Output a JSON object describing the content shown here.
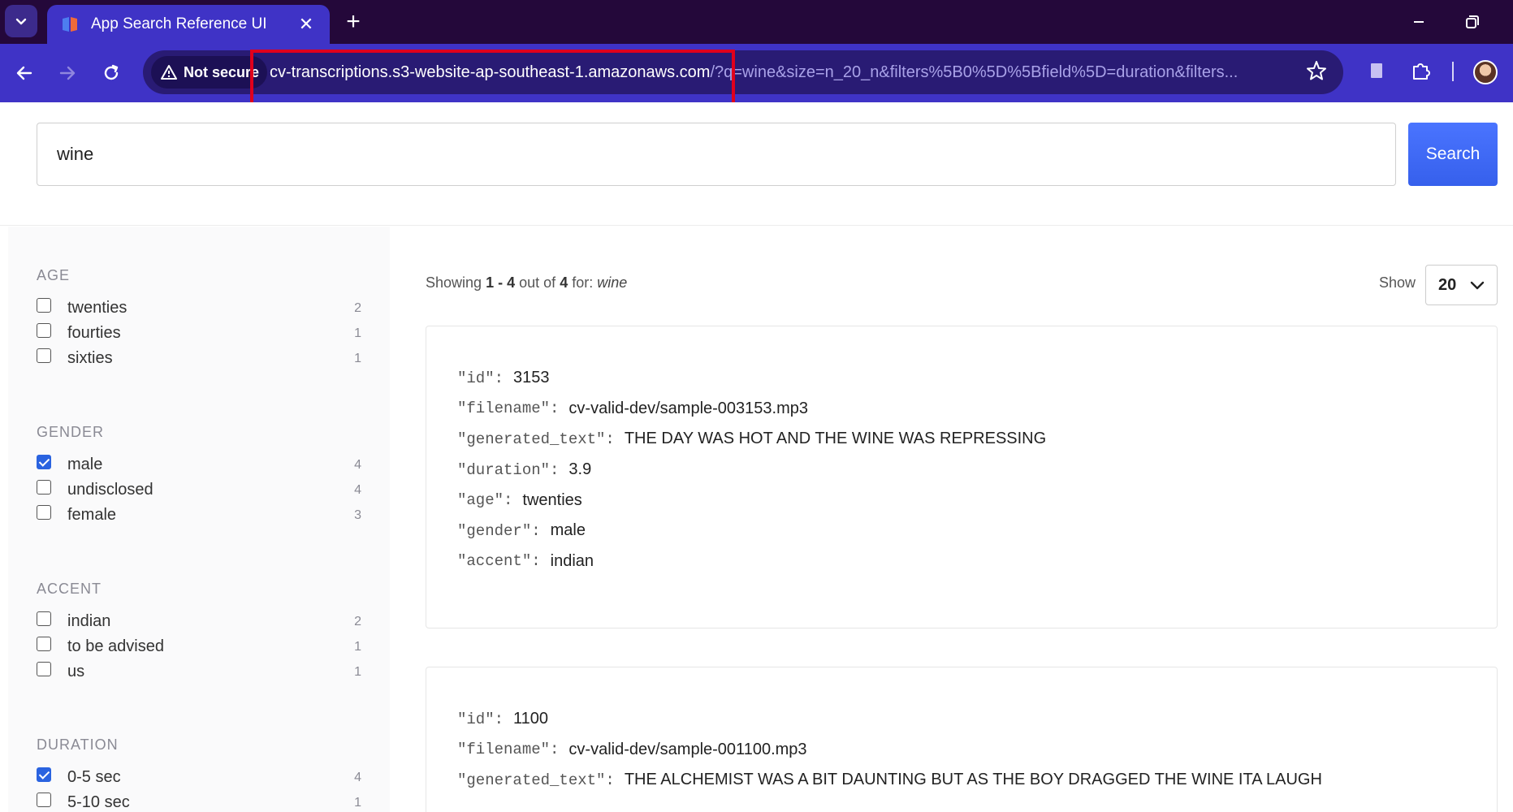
{
  "browser": {
    "tab_title": "App Search Reference UI",
    "security_label": "Not secure",
    "url_host": "cv-transcriptions.s3-website-ap-southeast-1.amazonaws.com",
    "url_rest": "/?q=wine&size=n_20_n&filters%5B0%5D%5Bfield%5D=duration&filters..."
  },
  "search": {
    "value": "wine",
    "button_label": "Search"
  },
  "facets": [
    {
      "title": "AGE",
      "options": [
        {
          "label": "twenties",
          "count": "2",
          "checked": false
        },
        {
          "label": "fourties",
          "count": "1",
          "checked": false
        },
        {
          "label": "sixties",
          "count": "1",
          "checked": false
        }
      ]
    },
    {
      "title": "GENDER",
      "options": [
        {
          "label": "male",
          "count": "4",
          "checked": true
        },
        {
          "label": "undisclosed",
          "count": "4",
          "checked": false
        },
        {
          "label": "female",
          "count": "3",
          "checked": false
        }
      ]
    },
    {
      "title": "ACCENT",
      "options": [
        {
          "label": "indian",
          "count": "2",
          "checked": false
        },
        {
          "label": "to be advised",
          "count": "1",
          "checked": false
        },
        {
          "label": "us",
          "count": "1",
          "checked": false
        }
      ]
    },
    {
      "title": "DURATION",
      "options": [
        {
          "label": "0-5 sec",
          "count": "4",
          "checked": true
        },
        {
          "label": "5-10 sec",
          "count": "1",
          "checked": false
        }
      ]
    }
  ],
  "results_header": {
    "prefix": "Showing",
    "start": "1",
    "dash": "-",
    "end": "4",
    "out_of": "out of",
    "total": "4",
    "for": "for:",
    "query": "wine"
  },
  "paging": {
    "show_label": "Show",
    "page_size": "20"
  },
  "results": [
    {
      "fields": [
        {
          "key": "\"id\":",
          "value": "3153"
        },
        {
          "key": "\"filename\":",
          "value": "cv-valid-dev/sample-003153.mp3"
        },
        {
          "key": "\"generated_text\":",
          "value": "THE DAY WAS HOT AND THE WINE WAS REPRESSING"
        },
        {
          "key": "\"duration\":",
          "value": "3.9"
        },
        {
          "key": "\"age\":",
          "value": "twenties"
        },
        {
          "key": "\"gender\":",
          "value": "male"
        },
        {
          "key": "\"accent\":",
          "value": "indian"
        }
      ]
    },
    {
      "fields": [
        {
          "key": "\"id\":",
          "value": "1100"
        },
        {
          "key": "\"filename\":",
          "value": "cv-valid-dev/sample-001100.mp3"
        },
        {
          "key": "\"generated_text\":",
          "value": "THE ALCHEMIST WAS A BIT DAUNTING BUT AS THE BOY DRAGGED THE WINE ITA LAUGH"
        }
      ]
    }
  ]
}
